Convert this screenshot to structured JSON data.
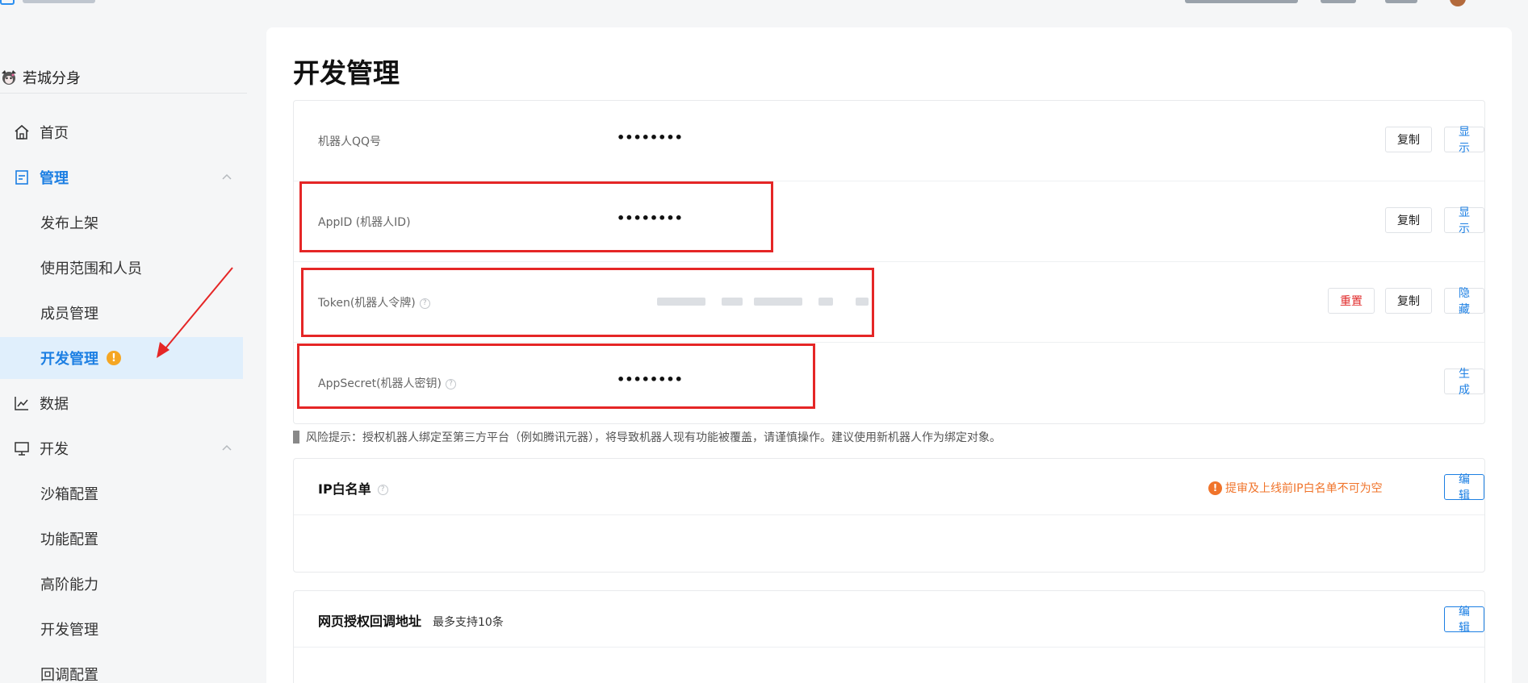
{
  "sidebar": {
    "bot_name": "若城分身",
    "items": [
      {
        "label": "首页"
      },
      {
        "label": "管理"
      },
      {
        "label": "发布上架"
      },
      {
        "label": "使用范围和人员"
      },
      {
        "label": "成员管理"
      },
      {
        "label": "开发管理",
        "badge": "!"
      },
      {
        "label": "数据"
      },
      {
        "label": "开发"
      },
      {
        "label": "沙箱配置"
      },
      {
        "label": "功能配置"
      },
      {
        "label": "高阶能力"
      },
      {
        "label": "开发管理"
      },
      {
        "label": "回调配置"
      }
    ]
  },
  "main": {
    "title": "开发管理",
    "credentials": [
      {
        "label": "机器人QQ号",
        "value": "••••••••",
        "copy": "复制",
        "toggle": "显示"
      },
      {
        "label": "AppID (机器人ID)",
        "value": "••••••••",
        "copy": "复制",
        "toggle": "显示"
      },
      {
        "label": "Token(机器人令牌)",
        "reset": "重置",
        "copy": "复制",
        "toggle": "隐藏"
      },
      {
        "label": "AppSecret(机器人密钥)",
        "value": "••••••••",
        "generate": "生成"
      }
    ],
    "risk_tip": "风险提示：授权机器人绑定至第三方平台（例如腾讯元器），将导致机器人现有功能被覆盖，请谨慎操作。建议使用新机器人作为绑定对象。",
    "ip_whitelist": {
      "title": "IP白名单",
      "warning": "提审及上线前IP白名单不可为空",
      "edit": "编辑"
    },
    "callback": {
      "title": "网页授权回调地址",
      "subtitle": "最多支持10条",
      "edit": "编辑"
    }
  },
  "colors": {
    "accent": "#1c7fe3",
    "danger": "#e02a2a",
    "warning": "#f0742b",
    "annotation": "#e52626"
  }
}
